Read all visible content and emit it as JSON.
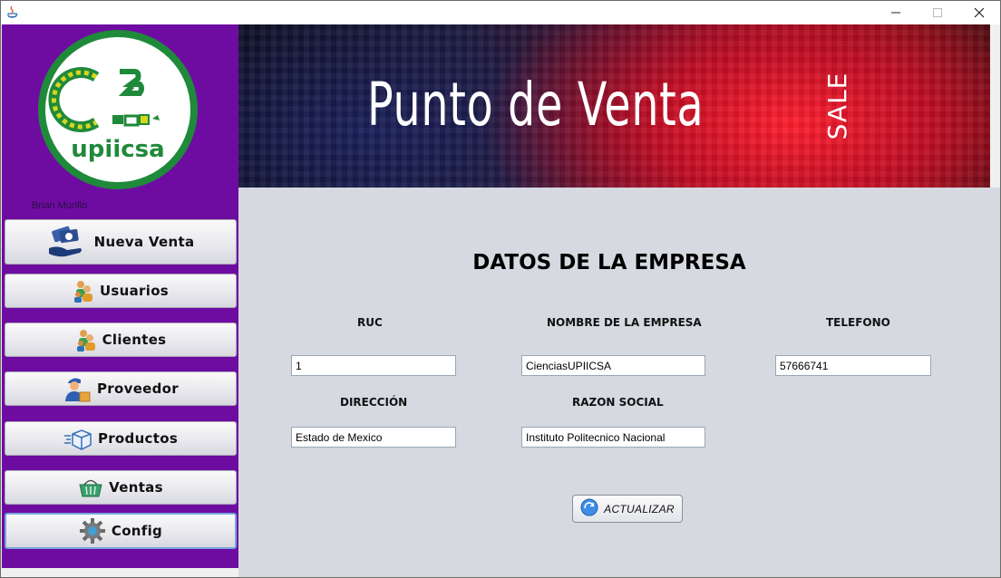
{
  "titlebar": {
    "minimize": "–",
    "maximize": "□",
    "close": "✕"
  },
  "sidebar": {
    "logo_text": "upiicsa",
    "user_name": "Brian Murillo",
    "items": [
      {
        "label": "Nueva Venta",
        "icon": "cash-hand-icon"
      },
      {
        "label": "Usuarios",
        "icon": "users-icon"
      },
      {
        "label": "Clientes",
        "icon": "clients-icon"
      },
      {
        "label": "Proveedor",
        "icon": "delivery-man-icon"
      },
      {
        "label": "Productos",
        "icon": "box-icon"
      },
      {
        "label": "Ventas",
        "icon": "basket-icon"
      },
      {
        "label": "Config",
        "icon": "gear-icon"
      }
    ]
  },
  "banner": {
    "title": "Punto de Venta",
    "sale": "SALE"
  },
  "form": {
    "heading": "DATOS DE LA EMPRESA",
    "ruc_label": "RUC",
    "ruc_value": "1",
    "empresa_label": "NOMBRE DE LA EMPRESA",
    "empresa_value": "CienciasUPIICSA",
    "telefono_label": "TELEFONO",
    "telefono_value": "57666741",
    "direccion_label": "DIRECCIÓN",
    "direccion_value": "Estado de Mexico",
    "razon_label": "RAZON SOCIAL",
    "razon_value": "Instituto Politecnico Nacional",
    "update_label": "ACTUALIZAR"
  },
  "colors": {
    "sidebar": "#6e0ca2",
    "main_bg": "#d6d9e0",
    "logo_green": "#1f8a3a",
    "logo_yellow": "#d8d61b"
  }
}
